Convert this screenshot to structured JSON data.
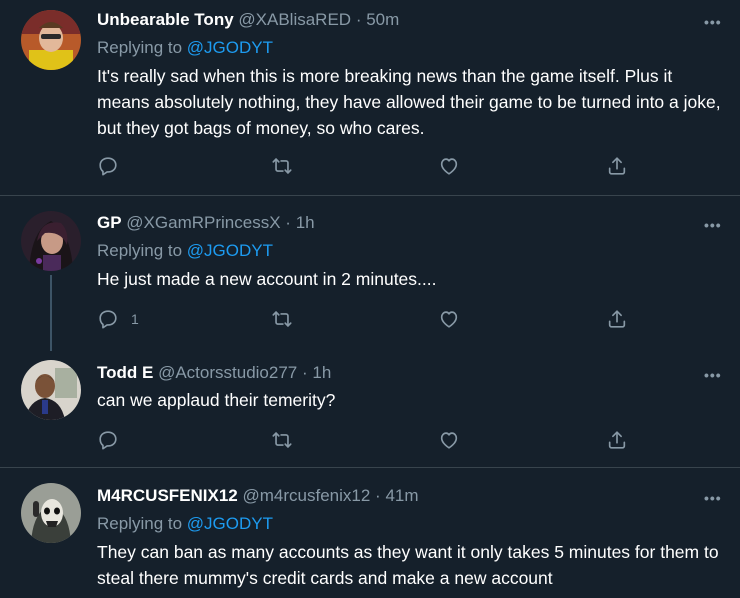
{
  "tweets": [
    {
      "name": "Unbearable Tony",
      "handle": "@XABlisaRED",
      "dot": "·",
      "time": "50m",
      "replying_prefix": "Replying to ",
      "replying_to": "@JGODYT",
      "text": "It's really sad when this is more breaking news than the game itself. Plus it means absolutely nothing, they have allowed their game to be turned into a joke, but they got bags of money, so who cares.",
      "reply_count": ""
    },
    {
      "name": "GP",
      "handle": "@XGamRPrincessX",
      "dot": "·",
      "time": "1h",
      "replying_prefix": "Replying to ",
      "replying_to": "@JGODYT",
      "text": "He just made a new account in 2 minutes....",
      "reply_count": "1"
    },
    {
      "name": "Todd E",
      "handle": "@Actorsstudio277",
      "dot": "·",
      "time": "1h",
      "text": "can we applaud their temerity?",
      "reply_count": ""
    },
    {
      "name": "M4RCUSFENIX12",
      "handle": "@m4rcusfenix12",
      "dot": "·",
      "time": "41m",
      "replying_prefix": "Replying to ",
      "replying_to": "@JGODYT",
      "text": "They can ban as many accounts as they want it only takes 5 minutes for them to steal there mummy's credit cards and make a new account"
    }
  ],
  "more_label": "•••",
  "icons": [
    "reply-icon",
    "retweet-icon",
    "like-icon",
    "share-icon",
    "more-icon"
  ],
  "colors": {
    "background": "#15202b",
    "separator": "#38444d",
    "secondary_text": "#8899a6",
    "link": "#1d9bf0"
  }
}
